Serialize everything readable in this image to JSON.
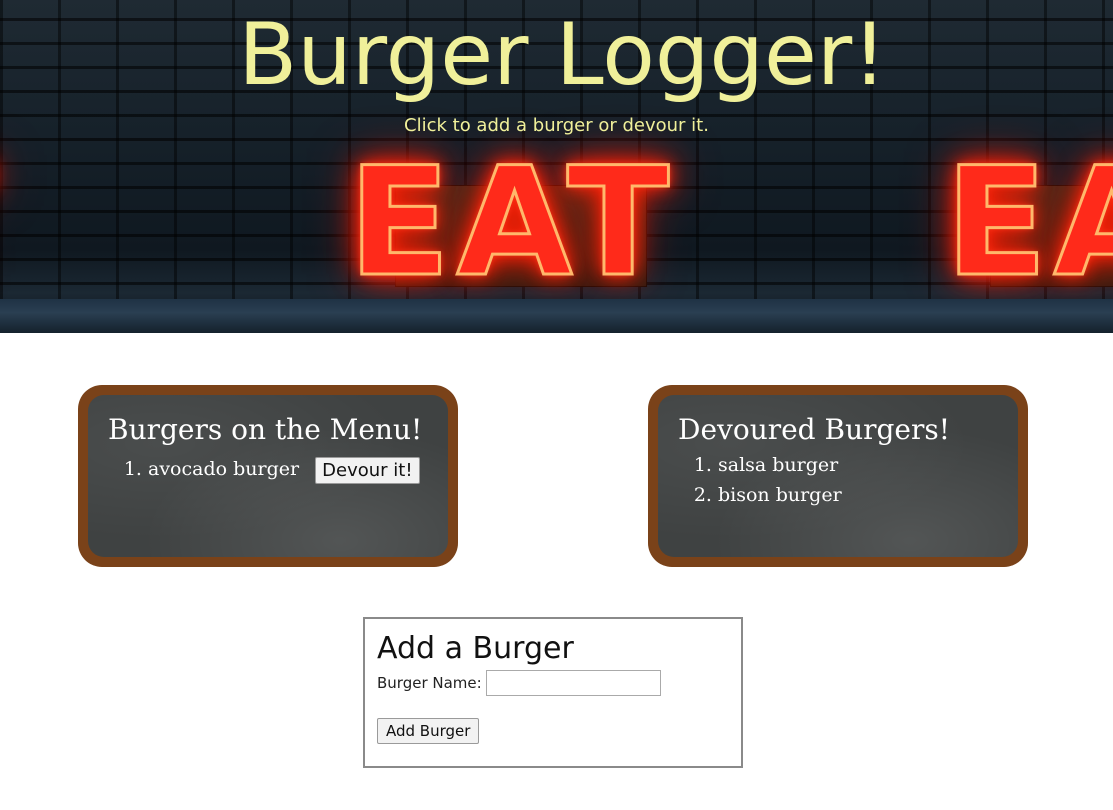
{
  "header": {
    "title": "Burger Logger!",
    "subtitle": "Click to add a burger or devour it.",
    "neon_sign_text": "EAT",
    "title_color": "#f0f09a",
    "neon_color": "#ff2a1a"
  },
  "menu": {
    "heading": "Burgers on the Menu!",
    "items": [
      {
        "name": "avocado burger",
        "button_label": "Devour it!"
      }
    ]
  },
  "devoured": {
    "heading": "Devoured Burgers!",
    "items": [
      {
        "name": "salsa burger"
      },
      {
        "name": "bison burger"
      }
    ]
  },
  "add_form": {
    "heading": "Add a Burger",
    "name_label": "Burger Name:",
    "name_value": "",
    "submit_label": "Add Burger"
  },
  "colors": {
    "board_frame": "#7a4219",
    "board_surface": "#3f4242"
  }
}
